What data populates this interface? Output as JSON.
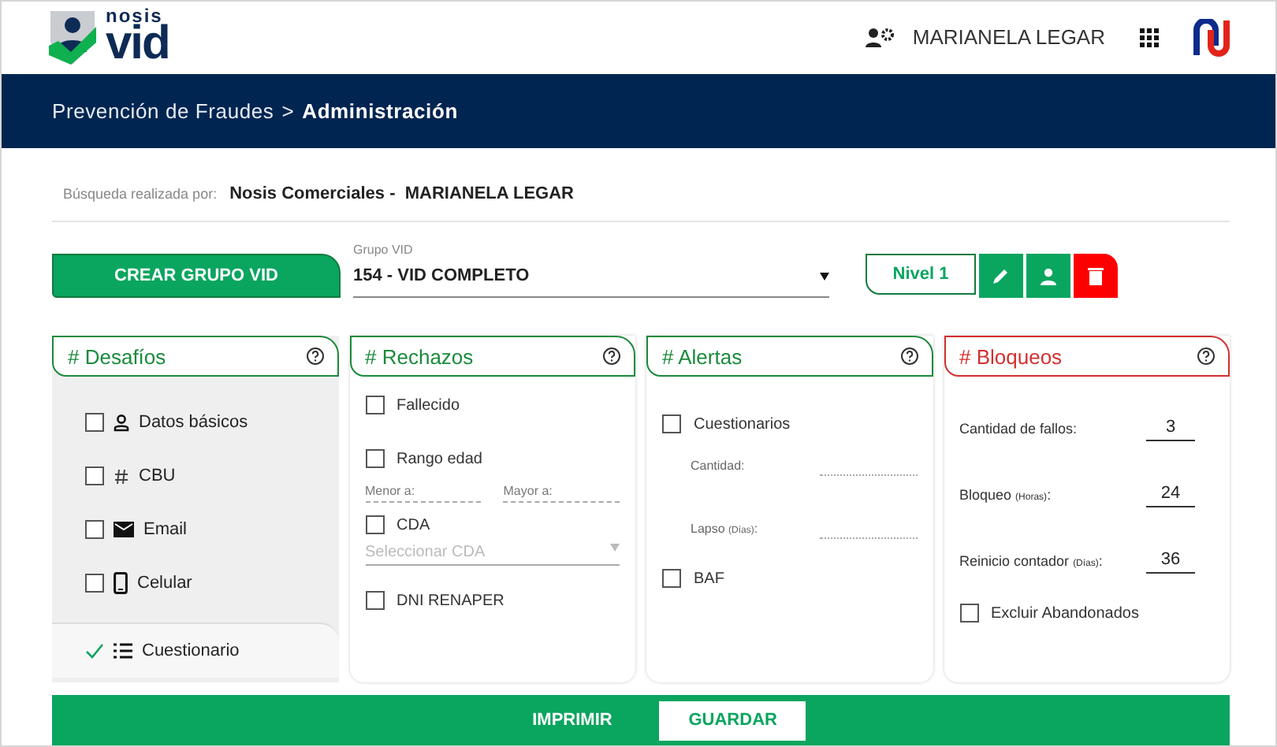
{
  "header": {
    "logo_small": "nosis",
    "logo_big": "vid",
    "user": "MARIANELA LEGAR"
  },
  "breadcrumb": {
    "parent": "Prevención de Fraudes",
    "separator": ">",
    "current": "Administración"
  },
  "search_by": {
    "label": "Búsqueda realizada por:",
    "value": "Nosis Comerciales -  MARIANELA LEGAR"
  },
  "toolbar": {
    "create_button": "CREAR GRUPO VID",
    "group_select": {
      "label": "Grupo VID",
      "value": "154 - VID COMPLETO"
    },
    "level": "Nivel 1"
  },
  "panels": [
    {
      "kind": "desafios",
      "title": "# Desafíos",
      "color": "#1a8a3c",
      "items": [
        {
          "label": "Datos básicos",
          "checked": false,
          "selected": false
        },
        {
          "label": "CBU",
          "checked": false,
          "selected": false
        },
        {
          "label": "Email",
          "checked": false,
          "selected": false
        },
        {
          "label": "Celular",
          "checked": false,
          "selected": false
        },
        {
          "label": "Cuestionario",
          "checked": true,
          "selected": true
        }
      ]
    },
    {
      "kind": "rechazos",
      "title": "# Rechazos",
      "color": "#1a8a3c",
      "items": [
        {
          "label": "Fallecido",
          "checked": false
        },
        {
          "label": "Rango edad",
          "checked": false,
          "fields": [
            {
              "placeholder": "Menor a:"
            },
            {
              "placeholder": "Mayor a:"
            }
          ]
        },
        {
          "label": "CDA",
          "checked": false,
          "select": {
            "placeholder": "Seleccionar CDA",
            "disabled": true
          }
        },
        {
          "label": "DNI RENAPER",
          "checked": false
        }
      ]
    },
    {
      "kind": "alertas",
      "title": "# Alertas",
      "color": "#1a8a3c",
      "items": [
        {
          "label": "Cuestionarios",
          "checked": false,
          "fields": [
            {
              "label": "Cantidad:"
            },
            {
              "label": "Lapso",
              "unit": "(Días)",
              "suffix": ":"
            }
          ]
        },
        {
          "label": "BAF",
          "checked": false
        }
      ]
    },
    {
      "kind": "bloqueos",
      "title": "# Bloqueos",
      "color": "#d32f2f",
      "fields": [
        {
          "label": "Cantidad de fallos:",
          "value": "3"
        },
        {
          "label": "Bloqueo",
          "unit": "(Horas)",
          "suffix": ":",
          "value": "24"
        },
        {
          "label": "Reinicio contador",
          "unit": "(Días)",
          "suffix": ":",
          "value": "36"
        }
      ],
      "items": [
        {
          "label": "Excluir Abandonados",
          "checked": false
        }
      ]
    }
  ],
  "footer": {
    "print_button": "IMPRIMIR",
    "save_button": "GUARDAR"
  }
}
